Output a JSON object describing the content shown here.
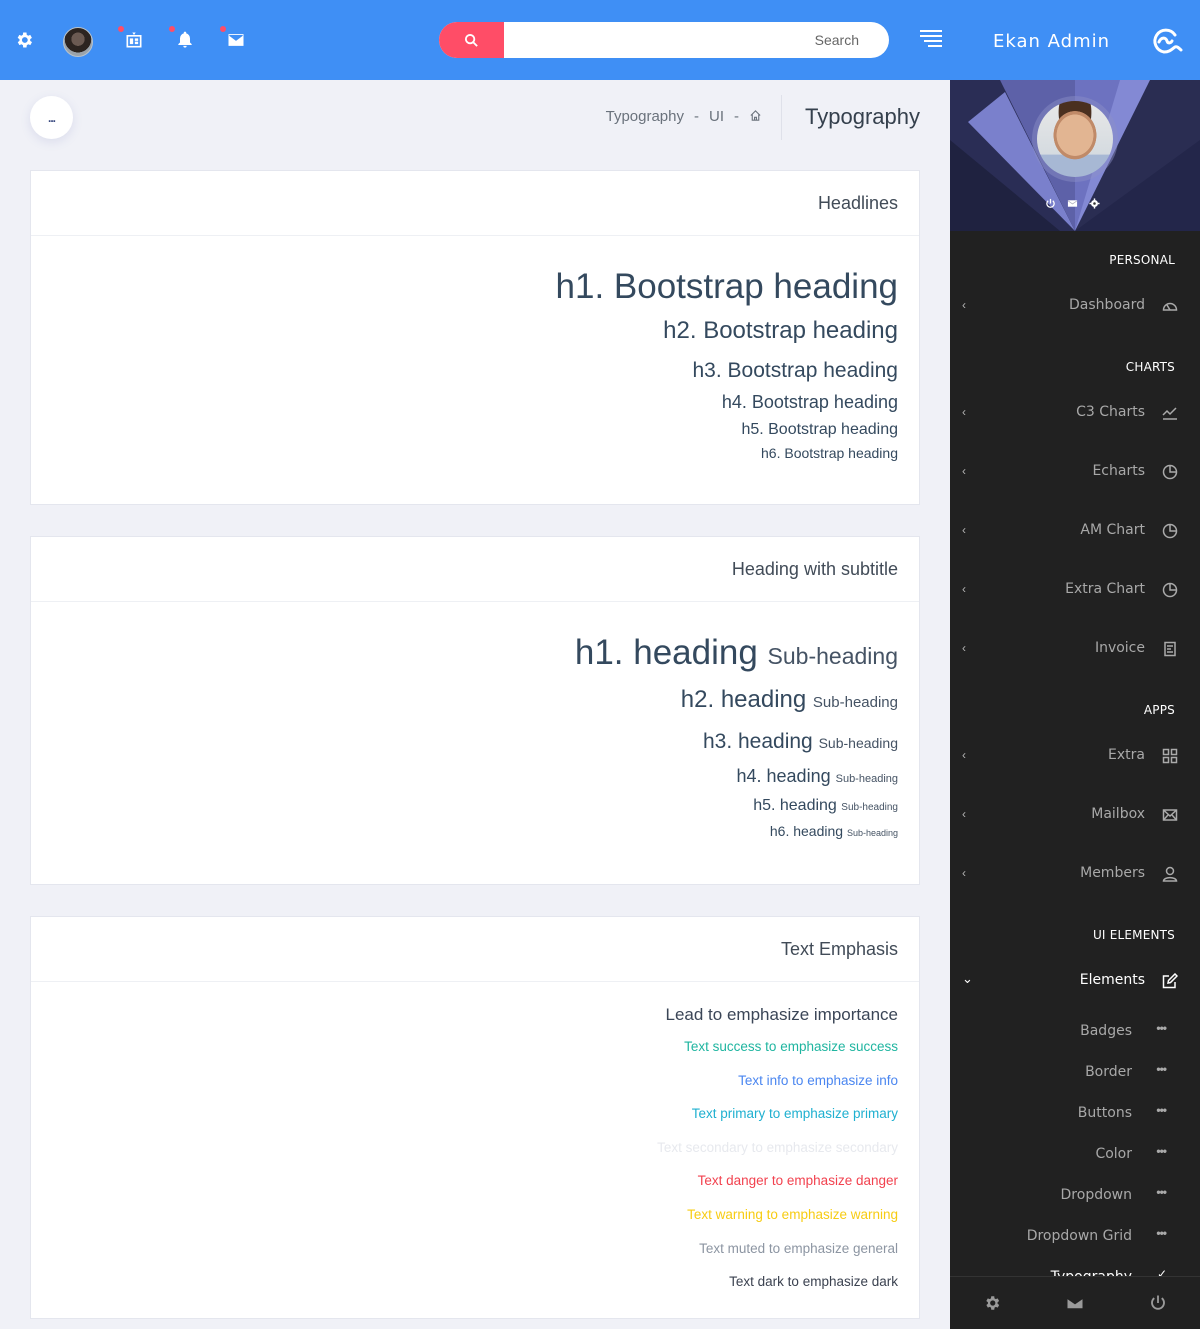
{
  "topbar": {
    "search_placeholder": "Search",
    "notification_dot_color": "#ff4d67",
    "accent_color": "#3f8ff5"
  },
  "brand": {
    "name": "Ekan Admin"
  },
  "header": {
    "menu_dots": "...",
    "breadcrumb": [
      "Typography",
      "UI"
    ],
    "breadcrumb_sep": "-",
    "page_title": "Typography"
  },
  "cards": {
    "headlines": {
      "title": "Headlines",
      "items": [
        "h1. Bootstrap heading",
        "h2. Bootstrap heading",
        "h3. Bootstrap heading",
        "h4. Bootstrap heading",
        "h5. Bootstrap heading",
        "h6. Bootstrap heading"
      ]
    },
    "subtitle": {
      "title": "Heading with subtitle",
      "items": [
        {
          "main": "h1. heading",
          "sub": "Sub-heading"
        },
        {
          "main": "h2. heading",
          "sub": "Sub-heading"
        },
        {
          "main": "h3. heading",
          "sub": "Sub-heading"
        },
        {
          "main": "h4. heading",
          "sub": "Sub-heading"
        },
        {
          "main": "h5. heading",
          "sub": "Sub-heading"
        },
        {
          "main": "h6. heading",
          "sub": "Sub-heading"
        }
      ]
    },
    "emphasis": {
      "title": "Text Emphasis",
      "lead": "Lead to emphasize importance",
      "items": [
        {
          "text": "Text success to emphasize success",
          "color": "#1fb5a0"
        },
        {
          "text": "Text info to emphasize info",
          "color": "#4a86f0"
        },
        {
          "text": "Text primary to emphasize primary",
          "color": "#1fb0d0"
        },
        {
          "text": "Text secondary to emphasize secondary",
          "color": "#e7e9ee"
        },
        {
          "text": "Text danger to emphasize danger",
          "color": "#f2424f"
        },
        {
          "text": "Text warning to emphasize warning",
          "color": "#f7cc13"
        },
        {
          "text": "Text muted to emphasize general",
          "color": "#8c95a2"
        },
        {
          "text": "Text dark to emphasize dark",
          "color": "#3b4250"
        }
      ]
    }
  },
  "sidebar": {
    "sections": {
      "personal": "PERSONAL",
      "charts": "CHARTS",
      "apps": "APPS",
      "ui_elements": "UI ELEMENTS"
    },
    "items": {
      "dashboard": "Dashboard",
      "c3": "C3 Charts",
      "echarts": "Echarts",
      "amchart": "AM Chart",
      "extrachart": "Extra Chart",
      "invoice": "Invoice",
      "extra": "Extra",
      "mailbox": "Mailbox",
      "members": "Members",
      "elements": "Elements"
    },
    "sub_items": [
      "Badges",
      "Border",
      "Buttons",
      "Color",
      "Dropdown",
      "Dropdown Grid",
      "Typography"
    ],
    "sub_dots": "•••"
  }
}
